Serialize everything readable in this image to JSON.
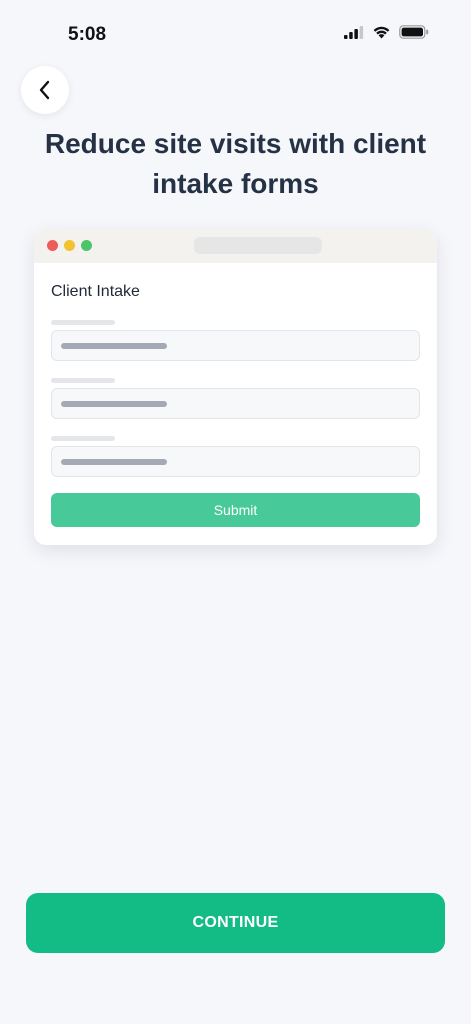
{
  "status_bar": {
    "time": "5:08",
    "icons": [
      "signal-icon",
      "wifi-icon",
      "battery-icon"
    ]
  },
  "header": {
    "back_icon": "chevron-left-icon"
  },
  "title": "Reduce site visits with client intake forms",
  "preview": {
    "window_dots": [
      "#ee5b5b",
      "#f2c230",
      "#4cc46a"
    ],
    "form_title": "Client Intake",
    "fields": [
      "field-1",
      "field-2",
      "field-3"
    ],
    "submit_label": "Submit"
  },
  "footer": {
    "continue_label": "CONTINUE"
  },
  "colors": {
    "accent": "#13bc84",
    "accent_light": "#48c99a",
    "background": "#f6f7fb",
    "title_text": "#253246"
  }
}
